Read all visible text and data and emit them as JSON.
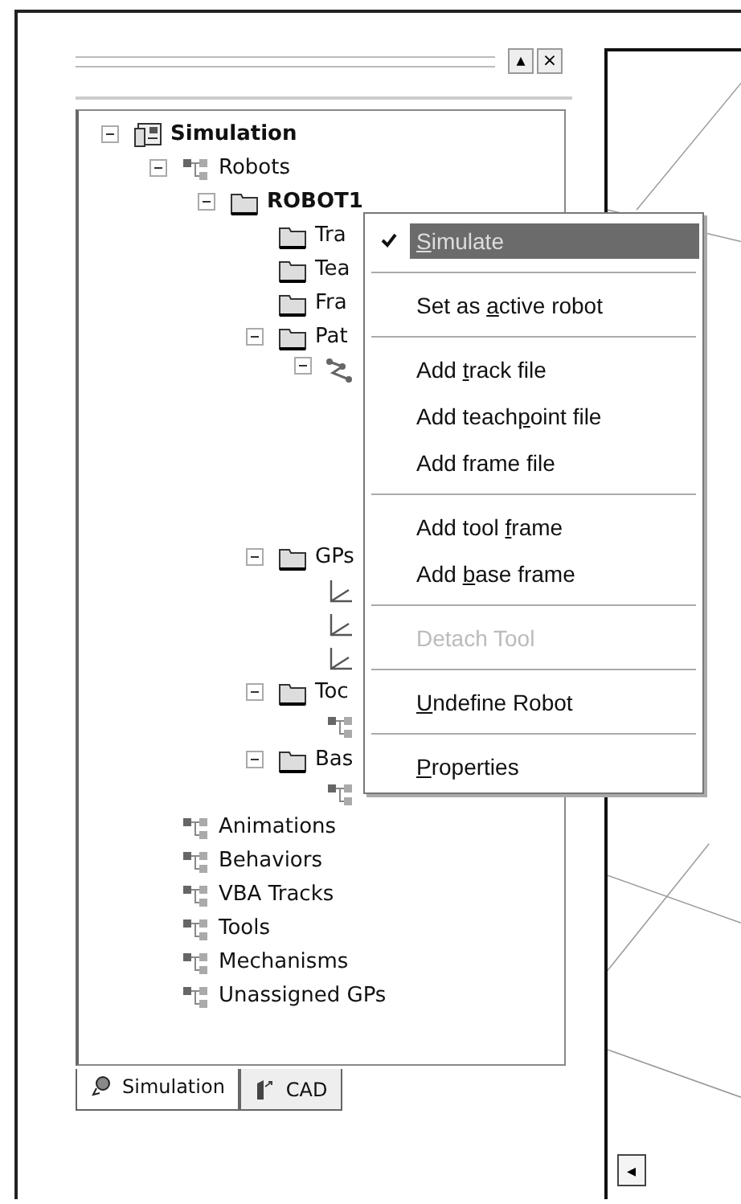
{
  "panel": {
    "header_buttons": [
      "▴",
      "×"
    ]
  },
  "tree": [
    {
      "label": "Simulation",
      "kind": "sim",
      "bold": true,
      "expanded": true,
      "children": [
        {
          "label": "Robots",
          "kind": "group",
          "bold": false,
          "expanded": true,
          "children": [
            {
              "label": "ROBOT1",
              "kind": "folder",
              "bold": true,
              "expanded": true,
              "children": [
                {
                  "label": "Tra",
                  "kind": "folder",
                  "bold": false
                },
                {
                  "label": "Tea",
                  "kind": "folder",
                  "bold": false
                },
                {
                  "label": "Fra",
                  "kind": "folder",
                  "bold": false
                },
                {
                  "label": "Pat",
                  "kind": "folder",
                  "bold": false,
                  "expanded": true,
                  "children": [
                    {
                      "kind": "path",
                      "expanded": true
                    }
                  ]
                },
                {
                  "label": "GPs",
                  "kind": "folder",
                  "bold": false,
                  "expanded": true,
                  "children": [
                    {
                      "kind": "frame"
                    },
                    {
                      "kind": "frame"
                    },
                    {
                      "kind": "frame"
                    }
                  ]
                },
                {
                  "label": "Toc",
                  "kind": "folder",
                  "bold": false,
                  "expanded": true,
                  "children": [
                    {
                      "kind": "group"
                    }
                  ]
                },
                {
                  "label": "Bas",
                  "kind": "folder",
                  "bold": false,
                  "expanded": true,
                  "children": [
                    {
                      "kind": "group"
                    }
                  ]
                }
              ]
            }
          ]
        },
        {
          "label": "Animations",
          "kind": "group",
          "bold": false
        },
        {
          "label": "Behaviors",
          "kind": "group",
          "bold": false
        },
        {
          "label": "VBA Tracks",
          "kind": "group",
          "bold": false
        },
        {
          "label": "Tools",
          "kind": "group",
          "bold": false
        },
        {
          "label": "Mechanisms",
          "kind": "group",
          "bold": false
        },
        {
          "label": "Unassigned GPs",
          "kind": "group",
          "bold": false
        }
      ]
    }
  ],
  "tabs": [
    {
      "label": "Simulation",
      "selected": true
    },
    {
      "label": "CAD",
      "selected": false
    }
  ],
  "context_menu": [
    {
      "kind": "item",
      "key": "S",
      "after": "imulate",
      "checked": true,
      "selected": true,
      "disabled": false
    },
    {
      "kind": "separator"
    },
    {
      "kind": "item",
      "before": "Set as ",
      "key": "a",
      "after": "ctive robot",
      "checked": false,
      "selected": false,
      "disabled": false
    },
    {
      "kind": "separator"
    },
    {
      "kind": "item",
      "before": "Add ",
      "key": "t",
      "after": "rack file",
      "checked": false,
      "selected": false,
      "disabled": false
    },
    {
      "kind": "item",
      "before": "Add teach",
      "key": "p",
      "after": "oint file",
      "checked": false,
      "selected": false,
      "disabled": false
    },
    {
      "kind": "item",
      "before": "Add frame file",
      "checked": false,
      "selected": false,
      "disabled": false
    },
    {
      "kind": "separator"
    },
    {
      "kind": "item",
      "before": "Add tool ",
      "key": "f",
      "after": "rame",
      "checked": false,
      "selected": false,
      "disabled": false
    },
    {
      "kind": "item",
      "before": "Add ",
      "key": "b",
      "after": "ase frame",
      "checked": false,
      "selected": false,
      "disabled": false
    },
    {
      "kind": "separator"
    },
    {
      "kind": "item",
      "before": "Detach Tool",
      "checked": false,
      "selected": false,
      "disabled": true
    },
    {
      "kind": "separator"
    },
    {
      "kind": "item",
      "key": "U",
      "after": "ndefine Robot",
      "checked": false,
      "selected": false,
      "disabled": false
    },
    {
      "kind": "separator"
    },
    {
      "kind": "item",
      "key": "P",
      "after": "roperties",
      "checked": false,
      "selected": false,
      "disabled": false
    }
  ],
  "viewport": {
    "scroll_button": "◂"
  }
}
